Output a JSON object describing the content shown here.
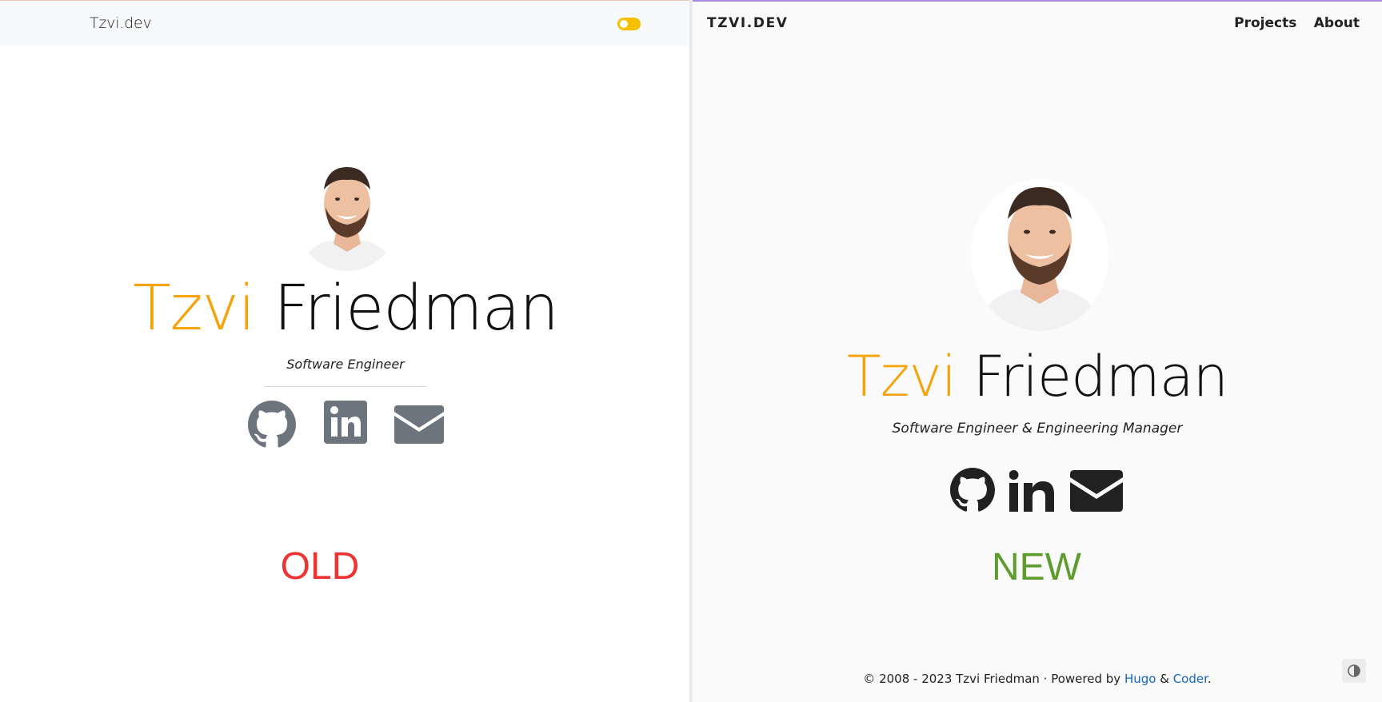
{
  "old": {
    "navbar": {
      "brand": "Tzvi.dev",
      "toggle_icon": "theme-toggle-switch",
      "toggle_color": "#f6c000"
    },
    "profile": {
      "avatar_icon": "profile-photo",
      "first_name": "Tzvi",
      "last_name": "Friedman",
      "role": "Software Engineer"
    },
    "social": [
      {
        "icon": "github-icon"
      },
      {
        "icon": "linkedin-icon"
      },
      {
        "icon": "email-icon"
      }
    ],
    "icon_color": "#6c757d",
    "label": "OLD",
    "label_color": "#ee3333"
  },
  "new": {
    "navbar": {
      "brand": "TZVI.DEV",
      "links": [
        "Projects",
        "About"
      ]
    },
    "profile": {
      "avatar_icon": "profile-photo",
      "first_name": "Tzvi",
      "last_name": "Friedman",
      "role": "Software Engineer & Engineering Manager"
    },
    "social": [
      {
        "icon": "github-icon"
      },
      {
        "icon": "linkedin-icon"
      },
      {
        "icon": "email-icon"
      }
    ],
    "icon_color": "#212121",
    "label": "NEW",
    "label_color": "#5f9c2f",
    "footer": {
      "prefix": "© 2008 - 2023 Tzvi Friedman · Powered by",
      "link1": "Hugo",
      "conjunction": "&",
      "link2": "Coder",
      "suffix": "."
    },
    "contrast_icon": "contrast-toggle-icon"
  },
  "accent_color": "#f6a20a"
}
